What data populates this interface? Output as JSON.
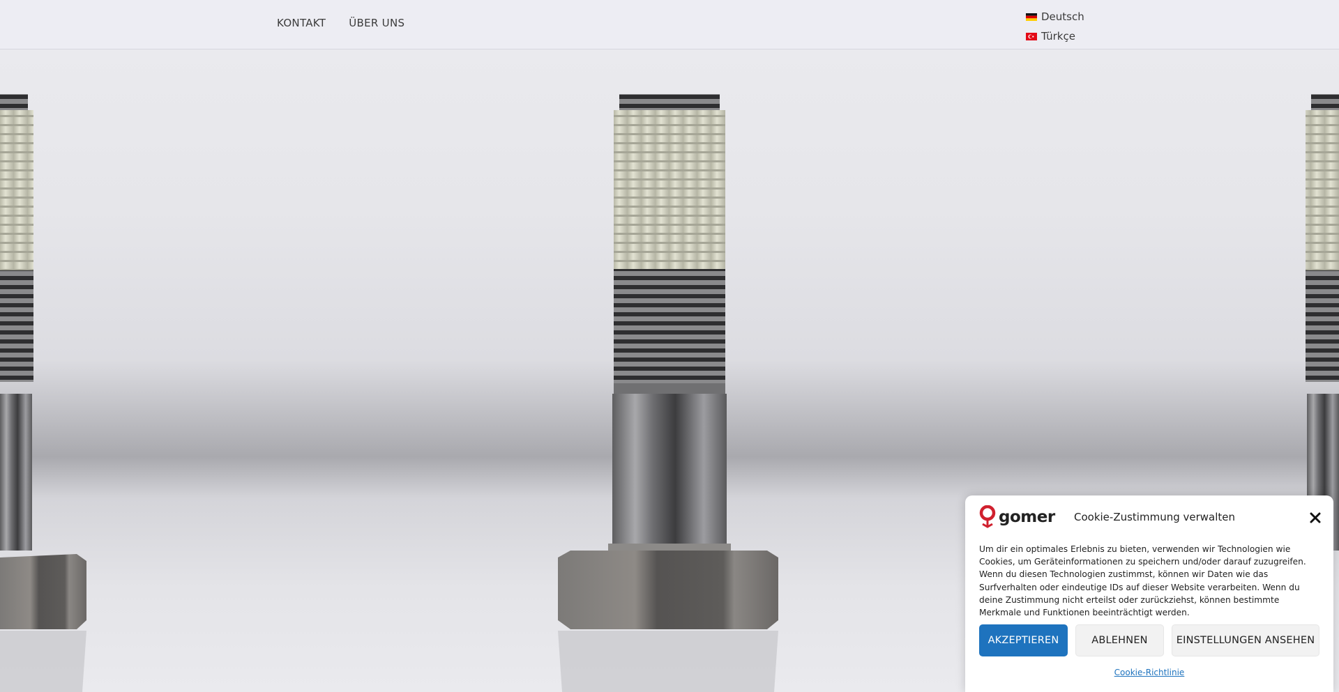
{
  "header": {
    "nav": [
      {
        "label": "KONTAKT"
      },
      {
        "label": "ÜBER UNS"
      }
    ],
    "languages": [
      {
        "label": "Deutsch",
        "flag": "de-flag-icon"
      },
      {
        "label": "Türkçe",
        "flag": "tr-flag-icon"
      }
    ]
  },
  "hero": {
    "image": "stainless-steel-bolts-photo"
  },
  "cookie_banner": {
    "brand": "gomer",
    "title": "Cookie-Zustimmung verwalten",
    "text": "Um dir ein optimales Erlebnis zu bieten, verwenden wir Technologien wie Cookies, um Geräteinformationen zu speichern und/oder darauf zuzugreifen. Wenn du diesen Technologien zustimmst, können wir Daten wie das Surfverhalten oder eindeutige IDs auf dieser Website verarbeiten. Wenn du deine Zustimmung nicht erteilst oder zurückziehst, können bestimmte Merkmale und Funktionen beeinträchtigt werden.",
    "accept_label": "AKZEPTIEREN",
    "deny_label": "ABLEHNEN",
    "preferences_label": "EINSTELLUNGEN ANSEHEN",
    "policy_link": "Cookie-Richtlinie"
  },
  "colors": {
    "accent": "#1e73be",
    "brand_red": "#d0202e"
  }
}
